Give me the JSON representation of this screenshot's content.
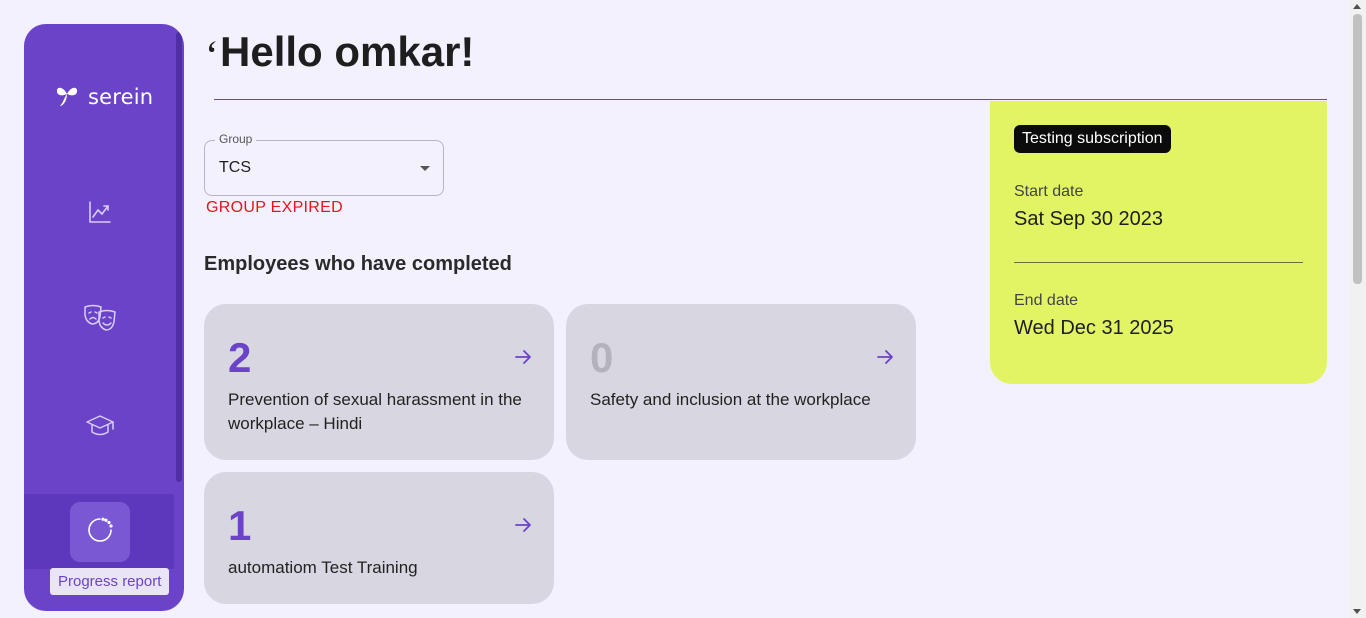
{
  "brand": {
    "name": "serein"
  },
  "sidebar": {
    "items": [
      {
        "icon": "chart-icon",
        "label": ""
      },
      {
        "icon": "theater-masks-icon",
        "label": ""
      },
      {
        "icon": "graduation-cap-icon",
        "label": ""
      },
      {
        "icon": "progress-circle-icon",
        "label": "Progress report",
        "active": true
      }
    ],
    "tooltip": "Progress report"
  },
  "header": {
    "greeting": "Hello omkar!"
  },
  "group_select": {
    "label": "Group",
    "value": "TCS",
    "status": "GROUP EXPIRED"
  },
  "section": {
    "title": "Employees who have completed"
  },
  "cards": [
    {
      "count": "2",
      "title": "Prevention of sexual harassment in the workplace – Hindi"
    },
    {
      "count": "0",
      "title": "Safety and inclusion at the workplace"
    },
    {
      "count": "1",
      "title": "automatiom Test Training"
    }
  ],
  "subscription": {
    "badge": "Testing subscription",
    "start_label": "Start date",
    "start_value": "Sat Sep 30 2023",
    "end_label": "End date",
    "end_value": "Wed Dec 31 2025"
  },
  "colors": {
    "accent": "#6a43c9",
    "panel": "#e2f464",
    "error": "#e5141f"
  }
}
